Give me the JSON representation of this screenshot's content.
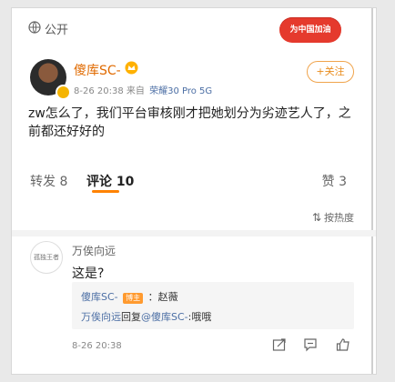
{
  "header": {
    "visibility_label": "公开",
    "campaign_badge": "为中国加油",
    "globe_icon": "globe-icon"
  },
  "post": {
    "username": "傻库SC-",
    "time": "8-26 20:38",
    "source_prefix": "来自",
    "device": "荣耀30 Pro 5G",
    "follow_label": "+关注",
    "text": "zw怎么了，我们平台审核刚才把她划分为劣迹艺人了，之前都还好好的"
  },
  "tabs": {
    "repost": "转发 8",
    "comment": "评论 10",
    "like": "赞 3"
  },
  "sort": {
    "label": "按热度",
    "icon": "sort-icon"
  },
  "comment": {
    "avatar_text": "孤独王者",
    "username": "万俟向远",
    "text": "这是?",
    "time": "8-26 20:38",
    "replies": [
      {
        "user": "傻库SC-",
        "badge": "博主",
        "sep": "：",
        "text": "赵薇"
      },
      {
        "user": "万俟向远",
        "mid": "回复",
        "target": "@傻库SC-",
        "sep": ":",
        "text": "哦哦"
      }
    ]
  },
  "colors": {
    "accent": "#ff8200",
    "link": "#4b6ea4",
    "username": "#e06a00"
  }
}
